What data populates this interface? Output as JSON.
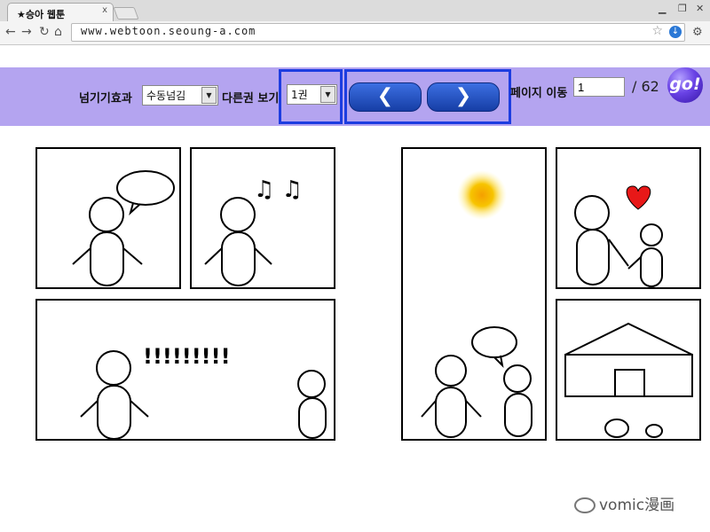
{
  "browser": {
    "tab_title": "★승아 웹툰",
    "tab_close": "x",
    "url": "www.webtoon.seoung-a.com"
  },
  "webtoon_bar": {
    "transition_label": "넘기기효과",
    "transition_value": "수동넘김",
    "other_volume_label": "다른권 보기",
    "volume_value": "1권",
    "prev_symbol": "❮",
    "next_symbol": "❯",
    "page_move_label": "페이지 이동",
    "page_value": "1",
    "page_total": "/ 62",
    "go_label": "go!"
  },
  "comic": {
    "exclaim_text": "!!!!!!!!!",
    "music_notes": "♫ ♫"
  },
  "watermark": {
    "text": "vomic漫画"
  },
  "colors": {
    "toolbar_bg": "#b4a4f0",
    "highlight": "#1d3de0",
    "button": "#1f4fc2"
  }
}
